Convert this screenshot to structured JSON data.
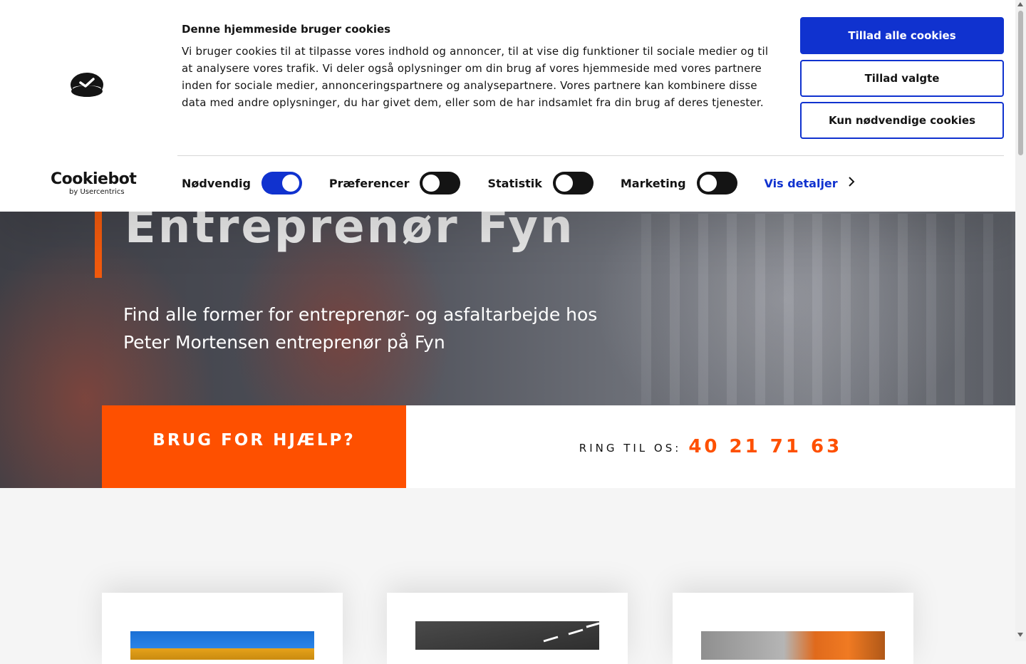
{
  "cookie_banner": {
    "title": "Denne hjemmeside bruger cookies",
    "body": "Vi bruger cookies til at tilpasse vores indhold og annoncer, til at vise dig funktioner til sociale medier og til at analysere vores trafik. Vi deler også oplysninger om din brug af vores hjemmeside med vores partnere inden for sociale medier, annonceringspartnere og analysepartnere. Vores partnere kan kombinere disse data med andre oplysninger, du har givet dem, eller som de har indsamlet fra din brug af deres tjenester.",
    "buttons": {
      "allow_all": "Tillad alle cookies",
      "allow_selected": "Tillad valgte",
      "necessary_only": "Kun nødvendige cookies"
    },
    "toggles": [
      {
        "label": "Nødvendig",
        "checked": true
      },
      {
        "label": "Præferencer",
        "checked": false
      },
      {
        "label": "Statistik",
        "checked": false
      },
      {
        "label": "Marketing",
        "checked": false
      }
    ],
    "details_link": "Vis detaljer",
    "brand": {
      "name": "Cookiebot",
      "byline": "by Usercentrics"
    },
    "colors": {
      "accent": "#1032cf",
      "text": "#141414"
    }
  },
  "hero": {
    "title": "Entreprenør Fyn",
    "subtitle": "Find alle former for entreprenør- og asfaltarbejde hos Peter Mortensen entreprenør på Fyn",
    "help_label": "BRUG FOR HJÆLP?",
    "call_label": "RING TIL OS:",
    "phone": "40 21 71 63",
    "colors": {
      "accent": "#fe5000"
    }
  },
  "cards": [
    {
      "image": "service-photo-excavator"
    },
    {
      "image": "service-photo-asphalt-road"
    },
    {
      "image": "service-photo-worker"
    }
  ]
}
